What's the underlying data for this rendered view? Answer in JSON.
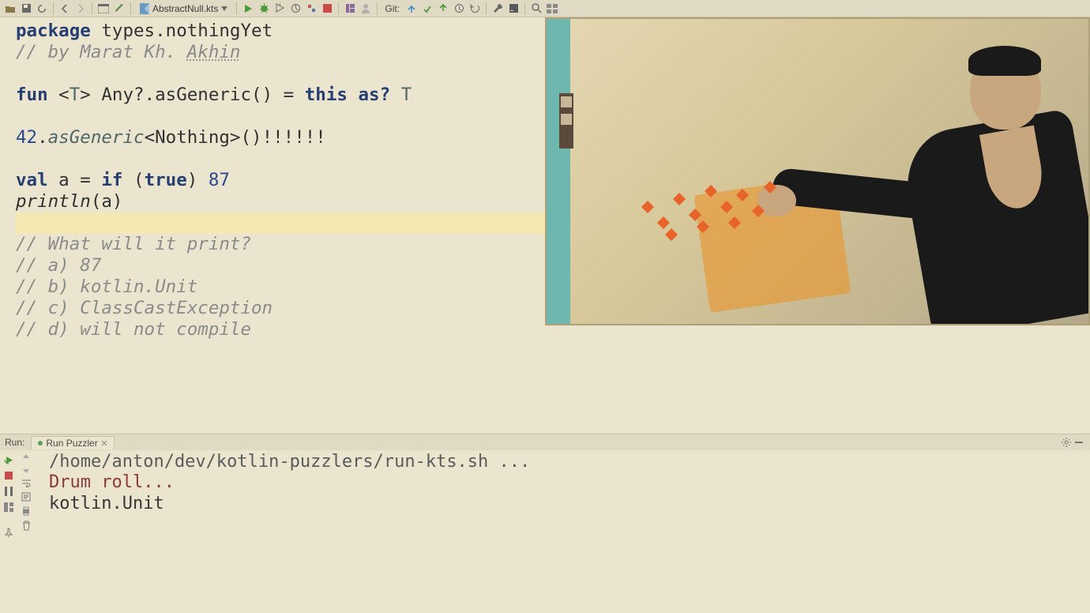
{
  "toolbar": {
    "file_name": "AbstractNull.kts",
    "git_label": "Git:"
  },
  "code": {
    "l1a": "package",
    "l1b": " types.nothingYet",
    "l2a": "// by Marat Kh. ",
    "l2b": "Akhin",
    "l4a": "fun",
    "l4b": " <",
    "l4c": "T",
    "l4d": "> Any?.asGeneric() = ",
    "l4e": "this",
    "l4f": " ",
    "l4g": "as?",
    "l4h": " ",
    "l4i": "T",
    "l6a": "42",
    "l6b": ".",
    "l6c": "asGeneric",
    "l6d": "<Nothing>()!!!!!!",
    "l8a": "val",
    "l8b": " a = ",
    "l8c": "if",
    "l8d": " (",
    "l8e": "true",
    "l8f": ") ",
    "l8g": "87",
    "l9a": "println",
    "l9b": "(a)",
    "l11": "// What will it print?",
    "l12": "// a) 87",
    "l13": "// b) kotlin.Unit",
    "l14": "// c) ClassCastException",
    "l15": "// d) will not compile"
  },
  "run": {
    "label": "Run:",
    "tab": "Run Puzzler",
    "line1": "/home/anton/dev/kotlin-puzzlers/run-kts.sh ...",
    "line2": "Drum roll...",
    "line3": "kotlin.Unit"
  }
}
